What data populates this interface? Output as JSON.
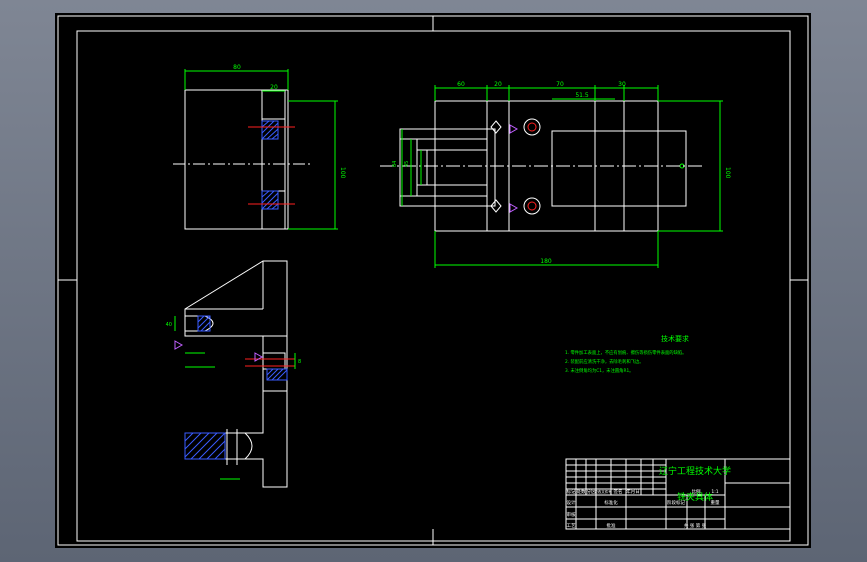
{
  "colors": {
    "background": "#6f7684",
    "sheet": "#000000",
    "outline": "#ffffff",
    "dimension": "#00ff00",
    "center": "#ff2020",
    "hatch": "#3a5cff",
    "symbol": "#c060ff"
  },
  "dimensions": {
    "left_width": "80",
    "left_inner": "20",
    "left_height": "100",
    "top_60": "60",
    "top_20": "20",
    "top_70": "70",
    "top_30": "30",
    "top_515": "51.5",
    "total_180": "180",
    "right_height": "100",
    "left_stack_a": "84",
    "left_stack_b": "45",
    "tri_a": "40",
    "tri_b": "8"
  },
  "technical_requirements": {
    "title": "技术要求",
    "lines": [
      "1. 零件加工表面上，不应有划痕、擦伤等损伤零件表面的缺陷。",
      "2. 装配前应清洗干净，去除毛刺和飞边。",
      "3. 未注倒角均为C1，未注圆角R1。"
    ]
  },
  "title_block": {
    "institution": "辽宁工程技术大学",
    "drawing_name": "铣夹具体",
    "scale_label": "比例",
    "scale_value": "1:1",
    "cells": [
      "标记",
      "处数",
      "分区",
      "更改文件号",
      "签名",
      "年月日",
      "设计",
      "标准化",
      "审核",
      "工艺",
      "批准",
      "阶段标记",
      "重量",
      "共 张 第 张"
    ]
  }
}
